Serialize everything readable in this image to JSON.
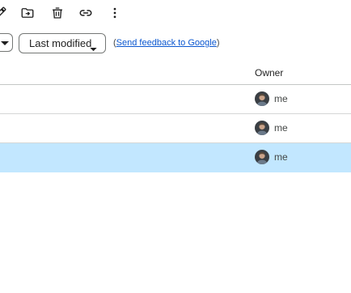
{
  "toolbar": {
    "icons": [
      "edit-icon",
      "move-to-folder-icon",
      "delete-icon",
      "link-icon",
      "more-vert-icon"
    ]
  },
  "filters": {
    "sort_chip_label": "Last modified",
    "feedback_prefix": "(",
    "feedback_link": "Send feedback to Google",
    "feedback_suffix": ")"
  },
  "table": {
    "columns": {
      "owner": "Owner"
    },
    "rows": [
      {
        "owner": "me",
        "selected": false
      },
      {
        "owner": "me",
        "selected": false
      },
      {
        "owner": "me",
        "selected": true
      }
    ]
  },
  "colors": {
    "selected_row": "#c2e7ff",
    "link": "#0b57d0",
    "chip_border": "#747775"
  }
}
